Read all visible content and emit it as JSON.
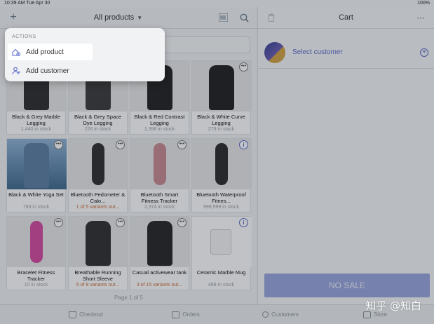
{
  "status_bar": {
    "time": "10:39 AM",
    "date": "Tue Apr 30",
    "battery": "100%"
  },
  "left_header": {
    "title": "All products"
  },
  "menu": {
    "header": "ACTIONS",
    "items": [
      {
        "label": "Add product",
        "icon": "add-product-icon"
      },
      {
        "label": "Add customer",
        "icon": "add-customer-icon"
      }
    ]
  },
  "products": [
    {
      "name": "Black & Grey Marble Legging",
      "stock": "1,440 in stock",
      "warn": false,
      "badge": "none"
    },
    {
      "name": "Black & Grey Space Dye Legging",
      "stock": "226 in stock",
      "warn": false,
      "badge": "none"
    },
    {
      "name": "Black & Red Contrast Legging",
      "stock": "1,396 in stock",
      "warn": false,
      "badge": "none"
    },
    {
      "name": "Black & White Curve Legging",
      "stock": "279 in stock",
      "warn": false,
      "badge": "more"
    },
    {
      "name": "Black & White Yoga Set",
      "stock": "783 in stock",
      "warn": false,
      "badge": "more"
    },
    {
      "name": "Bluetooth Pedometer & Calo...",
      "stock": "1 of 5 variants out...",
      "warn": true,
      "badge": "more"
    },
    {
      "name": "Bluetooth Smart Fitness Tracker",
      "stock": "2,374 in stock",
      "warn": false,
      "badge": "more"
    },
    {
      "name": "Bluetooth Waterproof Fitnes...",
      "stock": "999,999 in stock",
      "warn": false,
      "badge": "info"
    },
    {
      "name": "Bracelet Fitness Tracker",
      "stock": "10 in stock",
      "warn": false,
      "badge": "more"
    },
    {
      "name": "Breathable Running Short Sleeve",
      "stock": "5 of 8 variants out...",
      "warn": true,
      "badge": "more"
    },
    {
      "name": "Casual activewear tank",
      "stock": "3 of 15 variants out...",
      "warn": true,
      "badge": "more"
    },
    {
      "name": "Ceramic Marble Mug",
      "stock": "499 in stock",
      "warn": false,
      "badge": "info"
    }
  ],
  "pager": {
    "label": "Page 1 of 5"
  },
  "cart": {
    "title": "Cart",
    "select_customer": "Select customer",
    "no_sale": "NO SALE"
  },
  "bottom_nav": [
    {
      "label": "Checkout",
      "icon": "cart-icon"
    },
    {
      "label": "Orders",
      "icon": "orders-icon"
    },
    {
      "label": "Customers",
      "icon": "customers-icon"
    },
    {
      "label": "Store",
      "icon": "store-icon"
    }
  ],
  "watermark": "知乎 @知白",
  "colors": {
    "accent": "#5b6ac8",
    "warn": "#cc6a33",
    "nosale": "#9aa6e0"
  }
}
